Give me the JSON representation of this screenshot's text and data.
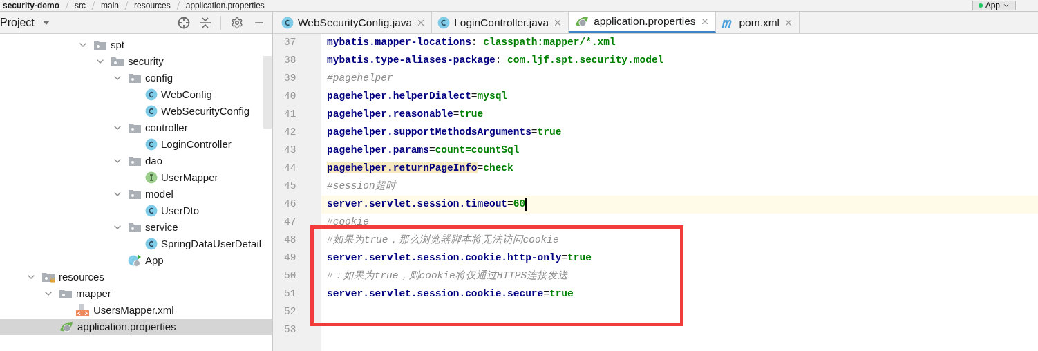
{
  "breadcrumb": [
    "security-demo",
    "src",
    "main",
    "resources",
    "application.properties"
  ],
  "run_config": {
    "label": "App"
  },
  "project_panel": {
    "title": "Project",
    "scrolled_items": [
      {
        "label": "spt",
        "kind": "folder",
        "expanded": true,
        "children": [
          {
            "label": "security",
            "kind": "folder",
            "expanded": true,
            "children": [
              {
                "label": "config",
                "kind": "folder",
                "expanded": true,
                "children": [
                  {
                    "label": "WebConfig",
                    "kind": "class"
                  },
                  {
                    "label": "WebSecurityConfig",
                    "kind": "class"
                  }
                ]
              },
              {
                "label": "controller",
                "kind": "folder",
                "expanded": true,
                "children": [
                  {
                    "label": "LoginController",
                    "kind": "class"
                  }
                ]
              },
              {
                "label": "dao",
                "kind": "folder",
                "expanded": true,
                "children": [
                  {
                    "label": "UserMapper",
                    "kind": "interface"
                  }
                ]
              },
              {
                "label": "model",
                "kind": "folder",
                "expanded": true,
                "children": [
                  {
                    "label": "UserDto",
                    "kind": "class"
                  }
                ]
              },
              {
                "label": "service",
                "kind": "folder",
                "expanded": true,
                "children": [
                  {
                    "label": "SpringDataUserDetail",
                    "kind": "class"
                  }
                ]
              },
              {
                "label": "App",
                "kind": "app"
              }
            ]
          }
        ]
      }
    ],
    "items": [
      {
        "label": "resources",
        "kind": "resources",
        "expanded": true,
        "children": [
          {
            "label": "mapper",
            "kind": "folder",
            "expanded": true,
            "children": [
              {
                "label": "UsersMapper.xml",
                "kind": "xml",
                "selected": false
              }
            ]
          },
          {
            "label": "application.properties",
            "kind": "properties",
            "selected": true
          }
        ]
      }
    ]
  },
  "tabs": [
    {
      "label": "WebSecurityConfig.java",
      "kind": "class",
      "selected": false
    },
    {
      "label": "LoginController.java",
      "kind": "class",
      "selected": false
    },
    {
      "label": "application.properties",
      "kind": "properties",
      "selected": true
    },
    {
      "label": "pom.xml",
      "kind": "maven",
      "selected": false
    }
  ],
  "editor": {
    "lines": [
      {
        "number": "37",
        "current": false,
        "boxed": false,
        "segments": [
          {
            "kind": "key",
            "text": "mybatis.mapper-locations"
          },
          {
            "kind": "sep",
            "text": ": "
          },
          {
            "kind": "value",
            "text": "classpath:mapper/*.xml"
          }
        ]
      },
      {
        "number": "38",
        "current": false,
        "boxed": false,
        "segments": [
          {
            "kind": "key",
            "text": "mybatis.type-aliases-package"
          },
          {
            "kind": "sep",
            "text": ": "
          },
          {
            "kind": "value",
            "text": "com.ljf.spt.security.model"
          }
        ]
      },
      {
        "number": "39",
        "current": false,
        "boxed": false,
        "segments": [
          {
            "kind": "comment",
            "text": "#pagehelper"
          }
        ]
      },
      {
        "number": "40",
        "current": false,
        "boxed": false,
        "segments": [
          {
            "kind": "key",
            "text": "pagehelper.helperDialect"
          },
          {
            "kind": "sep",
            "text": "="
          },
          {
            "kind": "value",
            "text": "mysql"
          }
        ]
      },
      {
        "number": "41",
        "current": false,
        "boxed": false,
        "segments": [
          {
            "kind": "key",
            "text": "pagehelper.reasonable"
          },
          {
            "kind": "sep",
            "text": "="
          },
          {
            "kind": "value",
            "text": "true"
          }
        ]
      },
      {
        "number": "42",
        "current": false,
        "boxed": false,
        "segments": [
          {
            "kind": "key",
            "text": "pagehelper.supportMethodsArguments"
          },
          {
            "kind": "sep",
            "text": "="
          },
          {
            "kind": "value",
            "text": "true"
          }
        ]
      },
      {
        "number": "43",
        "current": false,
        "boxed": false,
        "segments": [
          {
            "kind": "key",
            "text": "pagehelper.params"
          },
          {
            "kind": "sep",
            "text": "="
          },
          {
            "kind": "value",
            "text": "count=countSql"
          }
        ]
      },
      {
        "number": "44",
        "current": false,
        "boxed": false,
        "segments": [
          {
            "kind": "key_marked",
            "text": "pagehelper.returnPageInfo"
          },
          {
            "kind": "sep",
            "text": "="
          },
          {
            "kind": "value",
            "text": "check"
          }
        ]
      },
      {
        "number": "45",
        "current": false,
        "boxed": false,
        "segments": [
          {
            "kind": "comment",
            "text": "#session超时"
          }
        ]
      },
      {
        "number": "46",
        "current": true,
        "boxed": false,
        "segments": [
          {
            "kind": "key",
            "text": "server.servlet.session.timeout"
          },
          {
            "kind": "sep",
            "text": "="
          },
          {
            "kind": "value",
            "text": "60"
          }
        ]
      },
      {
        "number": "47",
        "current": false,
        "boxed": false,
        "segments": [
          {
            "kind": "comment",
            "text": "#cookie"
          }
        ]
      },
      {
        "number": "48",
        "current": false,
        "boxed": true,
        "segments": [
          {
            "kind": "comment",
            "text": "#如果为true，那么浏览器脚本将无法访问cookie"
          }
        ]
      },
      {
        "number": "49",
        "current": false,
        "boxed": true,
        "segments": [
          {
            "kind": "key",
            "text": "server.servlet.session.cookie.http-only"
          },
          {
            "kind": "sep",
            "text": "="
          },
          {
            "kind": "value",
            "text": "true"
          }
        ]
      },
      {
        "number": "50",
        "current": false,
        "boxed": true,
        "segments": [
          {
            "kind": "comment",
            "text": "#：如果为true，则cookie将仅通过HTTPS连接发送"
          }
        ]
      },
      {
        "number": "51",
        "current": false,
        "boxed": true,
        "segments": [
          {
            "kind": "key",
            "text": "server.servlet.session.cookie.secure"
          },
          {
            "kind": "sep",
            "text": "="
          },
          {
            "kind": "value",
            "text": "true"
          }
        ]
      },
      {
        "number": "52",
        "current": false,
        "boxed": true
      },
      {
        "number": "53",
        "current": false,
        "boxed": false
      }
    ]
  }
}
